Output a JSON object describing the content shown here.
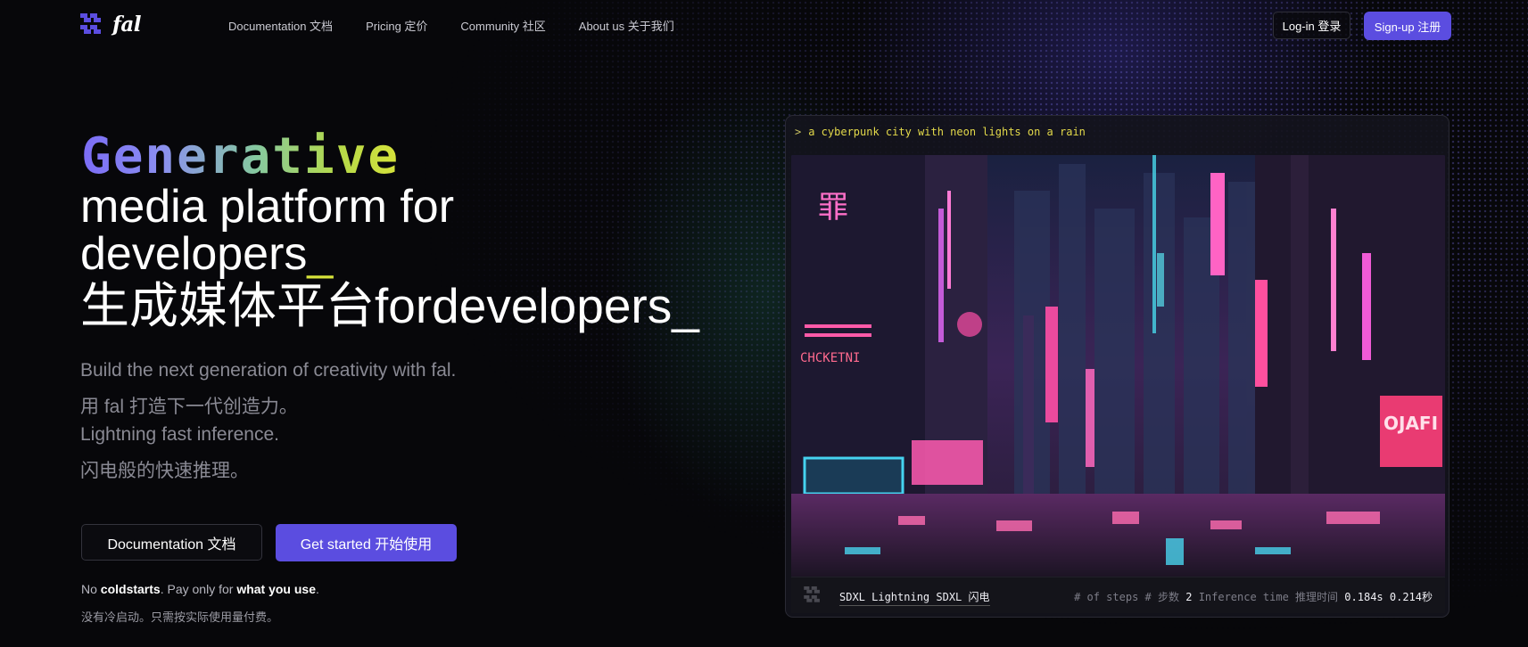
{
  "brand": {
    "name": "fal"
  },
  "nav": {
    "links": [
      "Documentation 文档",
      "Pricing 定价",
      "Community 社区",
      "About us 关于我们"
    ],
    "login": "Log-in 登录",
    "signup": "Sign-up 注册"
  },
  "hero": {
    "highlight": "Generative",
    "line1": "media platform for",
    "line2": "developers",
    "line3": "生成媒体平台fordevelopers",
    "cursor": "_",
    "sub1": "Build the next generation of creativity with fal.",
    "sub2": "用 fal 打造下一代创造力。",
    "sub3": "Lightning fast inference.",
    "sub4": "闪电般的快速推理。",
    "btn_docs": "Documentation 文档",
    "btn_start": "Get started 开始使用",
    "note_no": "No ",
    "note_coldstarts": "coldstarts",
    "note_mid": ". Pay only for ",
    "note_use": "what you use",
    "note_end": ".",
    "note_cn": "没有冷启动。只需按实际使用量付费。"
  },
  "demo": {
    "prompt_chevron": ">",
    "prompt": "a cyberpunk city with neon lights on a rain",
    "image_signs": [
      "罪",
      "CHCKETNI",
      "OJAFI"
    ],
    "model": "SDXL Lightning SDXL 闪电",
    "steps_label": "# of steps # 步数",
    "steps_value": "2",
    "time_label": "Inference time 推理时间",
    "time_value": "0.184s 0.214秒"
  },
  "colors": {
    "accent": "#5b4de0",
    "cursor": "#d6e23a",
    "prompt": "#e3d94a"
  }
}
